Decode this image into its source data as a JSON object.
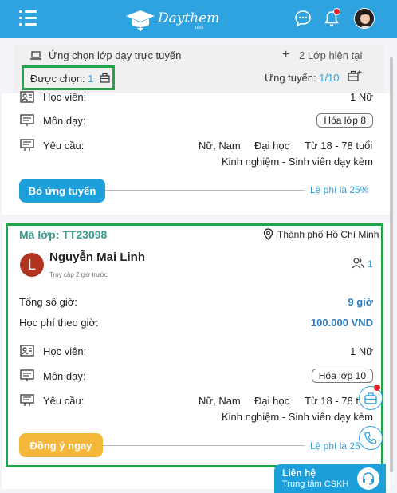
{
  "header": {
    "logo_text": "Daythem",
    "logo_sub": "1809",
    "icons": [
      "menu-icon",
      "chat-icon",
      "bell-icon",
      "avatar"
    ],
    "colors": {
      "primary": "#2ea3e0",
      "notification": "#e3262b"
    }
  },
  "filter": {
    "online_label": "Ứng chọn lớp dạy trực tuyến",
    "current_classes_label": "2 Lớp hiện tại",
    "chosen_label": "Được chọn:",
    "chosen_count": "1",
    "applied_label": "Ứng tuyển:",
    "applied_count": "1/10"
  },
  "card1": {
    "students_label": "Học viên:",
    "students_value": "1 Nữ",
    "subject_label": "Môn dạy:",
    "subject_value": "Hóa lớp 8",
    "requirements_label": "Yêu cầu:",
    "req_gender": "Nữ, Nam",
    "req_level": "Đại học",
    "req_age": "Từ 18 - 78 tuổi",
    "req_experience": "Kinh nghiệm - Sinh viên dạy kèm",
    "button": "Bỏ ứng tuyển",
    "fee": "Lệ phí là 25%"
  },
  "card2": {
    "class_code": "Mã lớp: TT23098",
    "city": "Thành phố Hồ Chí Minh",
    "avatar_letter": "L",
    "name": "Nguyễn Mai Linh",
    "last_access": "Truy cập 2 giờ trước",
    "people_count": "1",
    "hours_label": "Tổng số giờ:",
    "hours_value": "9 giờ",
    "fee_per_hour_label": "Học phí theo giờ:",
    "fee_per_hour_value": "100.000 VND",
    "students_label": "Học viên:",
    "students_value": "1 Nữ",
    "subject_label": "Môn dạy:",
    "subject_value": "Hóa lớp 10",
    "requirements_label": "Yêu cầu:",
    "req_gender": "Nữ, Nam",
    "req_level": "Đại học",
    "req_age": "Từ 18 - 78 t",
    "req_experience": "Kinh nghiệm - Sinh viên dạy kèm",
    "button": "Đồng ý ngay",
    "fee": "Lệ phí là 25"
  },
  "contact": {
    "title": "Liên hệ",
    "subtitle": "Trung tâm CSKH"
  }
}
